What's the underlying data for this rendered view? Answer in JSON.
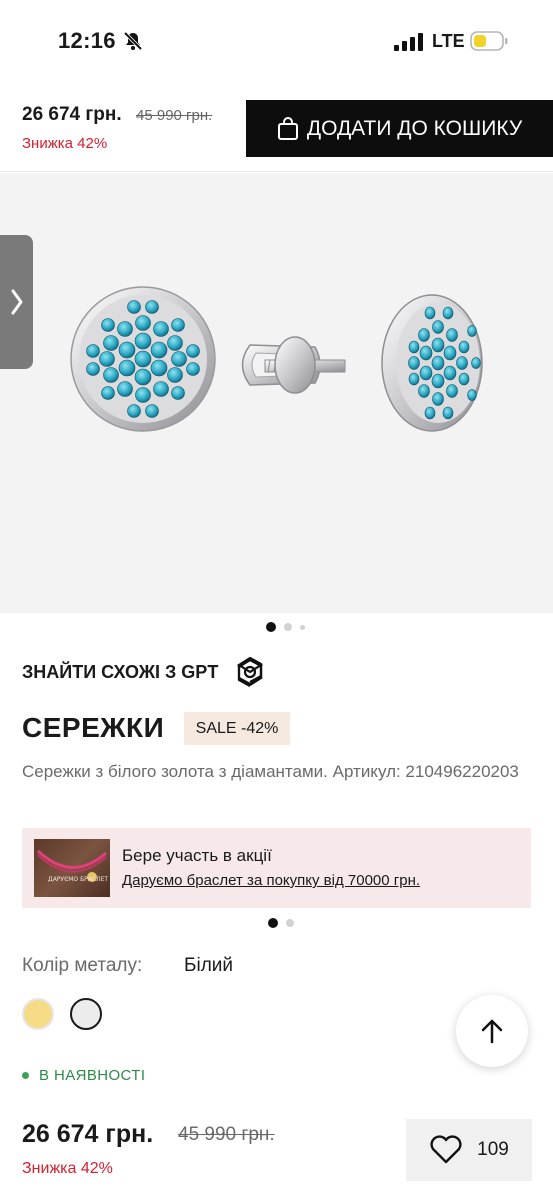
{
  "status_bar": {
    "time": "12:16",
    "network": "LTE"
  },
  "buy_bar": {
    "price": "26 674 грн.",
    "old_price": "45 990 грн.",
    "discount": "Знижка 42%",
    "add_to_cart": "ДОДАТИ ДО КОШИКУ"
  },
  "gallery": {
    "slide_count": 3,
    "active_slide": 1
  },
  "gpt": {
    "label": "ЗНАЙТИ СХОЖІ З GPT"
  },
  "product": {
    "title": "СЕРЕЖКИ",
    "sale_badge": "SALE -42%",
    "description": "Сережки з білого золота з діамантами. Артикул: 210496220203"
  },
  "promo": {
    "thumb_text": "ДАРУЄМО БРАСЛЕТ",
    "title": "Бере участь в акції",
    "link": "Даруємо браслет за покупку від 70000 грн."
  },
  "metal": {
    "label": "Колір металу:",
    "value": "Білий",
    "options": [
      "yellow",
      "white"
    ],
    "selected": "white"
  },
  "stock": {
    "label": "В НАЯВНОСТІ"
  },
  "bottom": {
    "price": "26 674 грн.",
    "old_price": "45 990 грн.",
    "discount": "Знижка 42%",
    "wishlist_count": "109"
  },
  "colors": {
    "accent_red": "#d42030",
    "in_stock_green": "#2f8a4a",
    "badge_bg": "#f6e9df",
    "promo_bg": "#f7e9ea"
  }
}
